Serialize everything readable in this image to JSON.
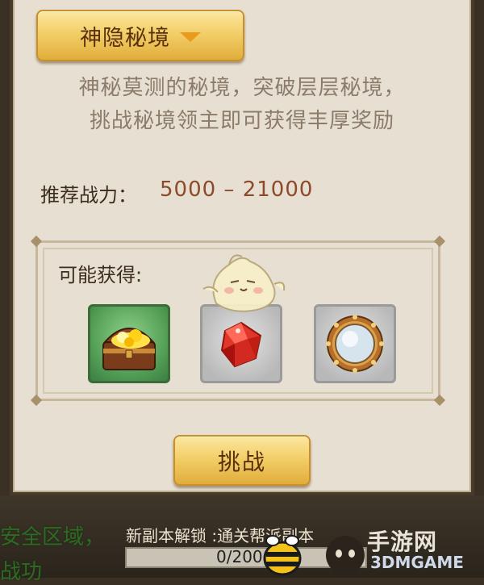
{
  "dungeon_select": {
    "label": "神隐秘境"
  },
  "description": {
    "line1": "神秘莫测的秘境，突破层层秘境，",
    "line2": "挑战秘境领主即可获得丰厚奖励"
  },
  "recommended_power": {
    "label": "推荐战力：",
    "value": "5000 – 21000"
  },
  "rewards": {
    "title": "可能获得:",
    "items": [
      {
        "icon": "treasure-chest-icon"
      },
      {
        "icon": "red-gem-icon"
      },
      {
        "icon": "mirror-orb-icon"
      }
    ]
  },
  "challenge_button": {
    "label": "挑战"
  },
  "bottom": {
    "left_line1": "安全区域，",
    "left_line2": "战功",
    "unlock_text": "新副本解锁 :通关帮派副本",
    "progress_text": "0/200",
    "progress_fraction": 0
  },
  "watermark": {
    "cn": "手游网",
    "en": "3DMGAME"
  },
  "colors": {
    "gold": "#f3cf69",
    "panel": "#e7e0d2",
    "power_value": "#8c4a2a"
  }
}
